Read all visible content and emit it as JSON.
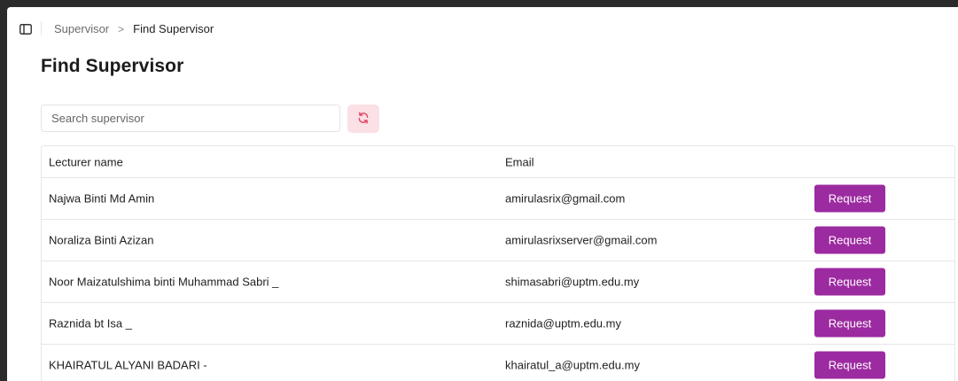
{
  "topbar": {
    "sidebar_toggle_icon": "sidebar-toggle-icon",
    "breadcrumb": {
      "parent": "Supervisor",
      "separator": ">",
      "current": "Find Supervisor"
    }
  },
  "main": {
    "title": "Find Supervisor",
    "search": {
      "placeholder": "Search supervisor",
      "value": ""
    },
    "refresh_icon": "refresh-icon",
    "colors": {
      "accent": "#9c2aa0",
      "refresh_bg": "#fbe0e6",
      "refresh_icon": "#e0455e"
    }
  },
  "table": {
    "headers": {
      "name": "Lecturer name",
      "email": "Email",
      "action": ""
    },
    "rows": [
      {
        "name": "Najwa Binti Md Amin",
        "email": "amirulasrix@gmail.com",
        "action": "Request"
      },
      {
        "name": "Noraliza Binti Azizan",
        "email": "amirulasrixserver@gmail.com",
        "action": "Request"
      },
      {
        "name": "Noor Maizatulshima binti Muhammad Sabri _",
        "email": "shimasabri@uptm.edu.my",
        "action": "Request"
      },
      {
        "name": "Raznida bt Isa _",
        "email": "raznida@uptm.edu.my",
        "action": "Request"
      },
      {
        "name": "KHAIRATUL ALYANI BADARI -",
        "email": "khairatul_a@uptm.edu.my",
        "action": "Request"
      }
    ]
  }
}
